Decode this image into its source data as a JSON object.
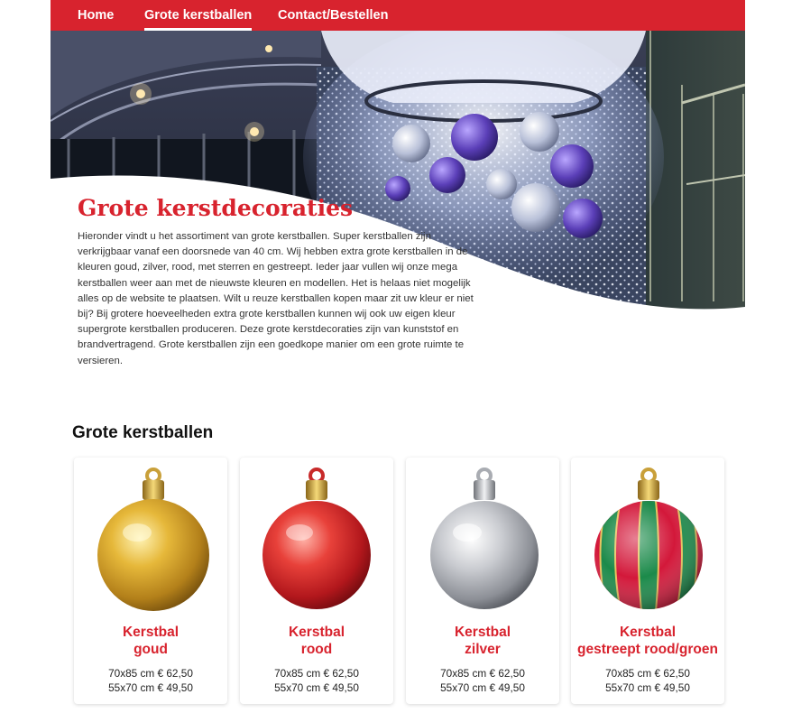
{
  "colors": {
    "brand_red": "#d8232e",
    "text": "#333333"
  },
  "nav": {
    "items": [
      {
        "label": "Home",
        "active": false
      },
      {
        "label": "Grote kerstballen",
        "active": true
      },
      {
        "label": "Contact/Bestellen",
        "active": false
      }
    ]
  },
  "intro": {
    "title": "Grote kerstdecoraties",
    "body": "Hieronder vindt u het assortiment van grote kerstballen. Super kerstballen zijn verkrijgbaar vanaf een doorsnede van 40 cm. Wij hebben extra grote kerstballen in de kleuren goud, zilver, rood, met sterren en gestreept. Ieder jaar vullen wij onze mega kerstballen weer aan met de nieuwste kleuren en modellen. Het is helaas niet mogelijk alles op de website te plaatsen. Wilt u reuze kerstballen kopen maar zit uw kleur er niet bij? Bij grotere hoeveelheden extra grote kerstballen kunnen wij ook uw eigen kleur supergrote kerstballen produceren. Deze grote kerstdecoraties zijn van kunststof en brandvertragend. Grote kerstballen zijn een goedkope manier om een grote ruimte te versieren."
  },
  "products_section": {
    "title": "Grote kerstballen",
    "items": [
      {
        "name_line1": "Kerstbal",
        "name_line2": "goud",
        "price1": "70x85 cm € 62,50",
        "price2": "55x70 cm € 49,50",
        "image": "gold-ornament"
      },
      {
        "name_line1": "Kerstbal",
        "name_line2": "rood",
        "price1": "70x85 cm € 62,50",
        "price2": "55x70 cm € 49,50",
        "image": "red-ornament"
      },
      {
        "name_line1": "Kerstbal",
        "name_line2": "zilver",
        "price1": "70x85 cm € 62,50",
        "price2": "55x70 cm € 49,50",
        "image": "silver-ornament"
      },
      {
        "name_line1": "Kerstbal",
        "name_line2": "gestreept rood/groen",
        "price1": "70x85 cm € 62,50",
        "price2": "55x70 cm € 49,50",
        "image": "striped-ornament"
      }
    ]
  }
}
